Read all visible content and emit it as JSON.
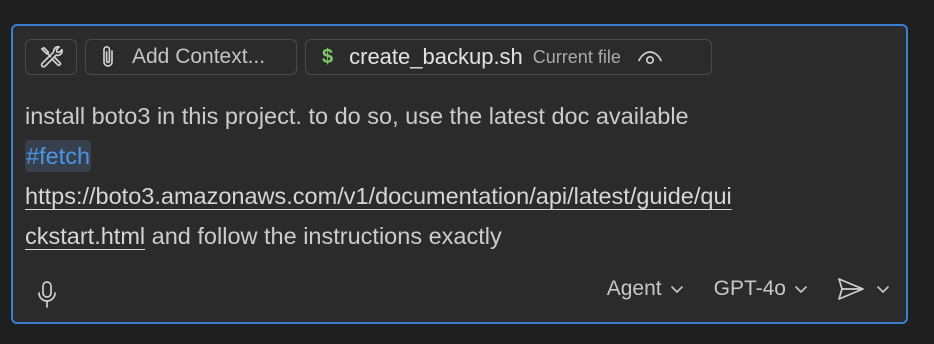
{
  "toolbar": {
    "tools_icon": "tools-icon",
    "add_context_icon": "paperclip-icon",
    "add_context_label": "Add Context...",
    "file": {
      "icon": "dollar-icon",
      "icon_glyph": "$",
      "name": "create_backup.sh",
      "status": "Current file",
      "visibility_icon": "eye-icon"
    }
  },
  "prompt": {
    "line1": "install boto3 in this project. to do so, use the latest doc available",
    "tag": "#fetch",
    "url_part1": "https://boto3.amazonaws.com/v1/documentation/api/latest/guide/qui",
    "url_part2": "ckstart.html",
    "line4_rest": " and follow the instructions exactly"
  },
  "footer": {
    "mic_icon": "microphone-icon",
    "mode_label": "Agent",
    "model_label": "GPT-4o",
    "send_icon": "send-icon"
  },
  "colors": {
    "border_accent": "#3b7fd0",
    "tag_text": "#4d95e6",
    "dollar_green": "#7ec86a",
    "panel_bg": "#2b2b2b"
  }
}
